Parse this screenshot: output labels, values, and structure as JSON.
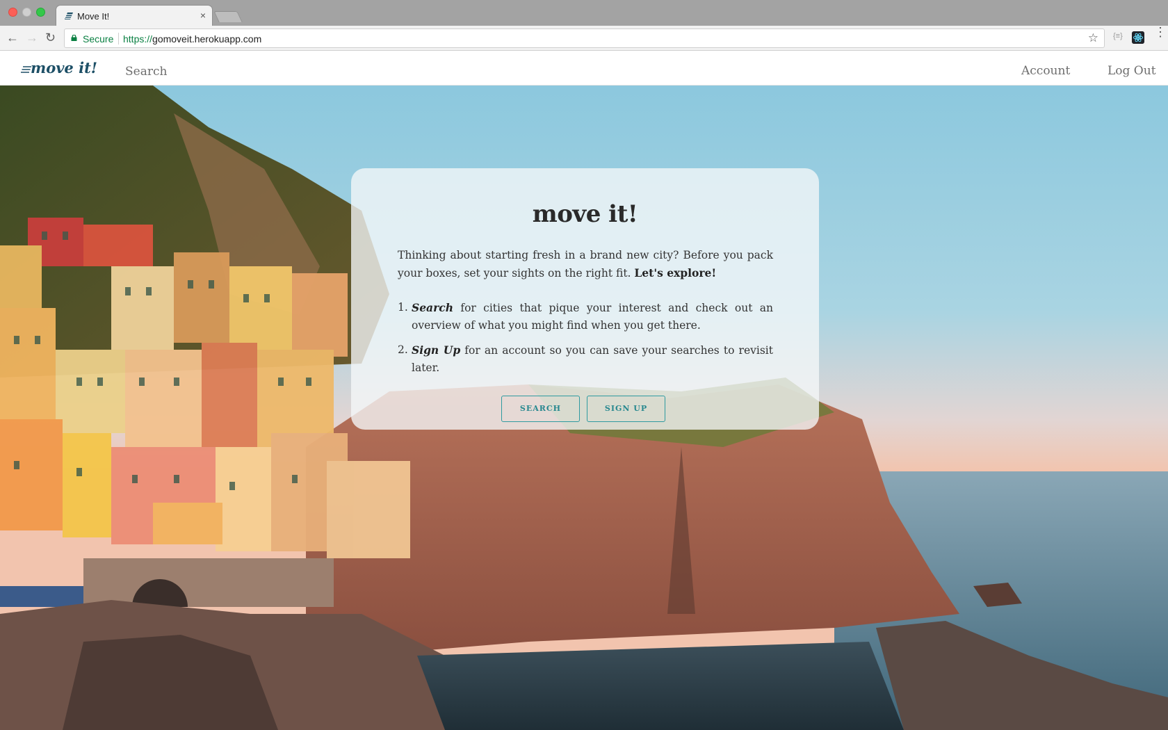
{
  "browser": {
    "tab_title": "Move It!",
    "tab_close": "×",
    "secure_label": "Secure",
    "url_scheme": "https://",
    "url_host": "gomoveit.herokuapp.com",
    "back_icon": "←",
    "forward_icon": "→",
    "reload_icon": "↻",
    "star_icon": "☆",
    "ext_label": "{≡}",
    "menu_icon": "⋮"
  },
  "navbar": {
    "logo_text": "move it!",
    "search_link": "Search",
    "account_link": "Account",
    "logout_link": "Log Out"
  },
  "card": {
    "title": "move it!",
    "intro_text": "Thinking about starting fresh in a brand new city? Before you pack your boxes, set your sights on the right fit. ",
    "intro_emphasis": "Let's explore!",
    "steps": [
      {
        "number": "1.",
        "keyword": "Search",
        "text": " for cities that pique your interest and check out an overview of what you might find when you get there."
      },
      {
        "number": "2.",
        "keyword": "Sign Up",
        "text": " for an account so you can save your searches to revisit later."
      }
    ],
    "search_button": "SEARCH",
    "signup_button": "SIGN UP"
  },
  "colors": {
    "accent": "#2e9aa0",
    "logo": "#1d4f66",
    "secure_green": "#0b8043"
  }
}
